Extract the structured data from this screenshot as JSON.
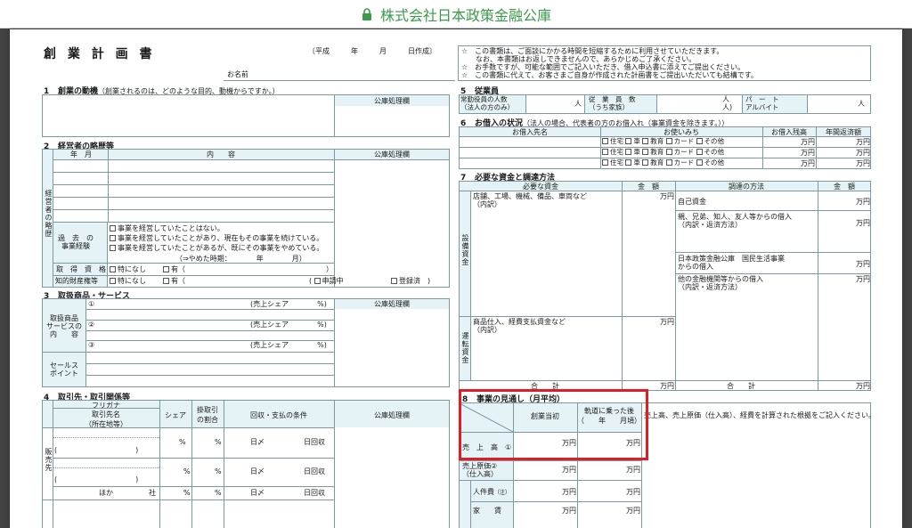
{
  "browser": {
    "title": "株式会社日本政策金融公庫",
    "accent": "#3a9b4a"
  },
  "doc": {
    "title": "創 業 計 画 書",
    "date_line": "〔平成　　　年　　　月　　　日作成〕",
    "name_label": "お名前",
    "notes": [
      "☆　この書類は、ご面談にかかる時間を短縮するために利用させていただきます。",
      "　　なお、本書類はお返しできませんので、あらかじめご了承ください。",
      "☆　お手数ですが、可能な範囲でご記入いただき、借入申込書に添えてご提出ください。",
      "☆　この書類に代えて、お客さまご自身が作成された計画書をご提出いただいても結構です。"
    ],
    "office_col": "公庫処理欄",
    "s1": {
      "num": "1",
      "title": "創業の動機",
      "sub": "（創業されるのは、どのような目的、動機からですか。）"
    },
    "s2": {
      "num": "2",
      "title": "経営者の略歴等",
      "col_ym": "年　月",
      "col_content": "内　　容",
      "side": "経営者の略歴",
      "past": "過　去　の\n事業経験",
      "opt1": "事業を経営していたことはない。",
      "opt2": "事業を経営していたことがあり、現在もその事業を続けている。",
      "opt3": "事業を経営していたことがあるが、既にその事業をやめている。",
      "quit": "（⇒やめた時期：　　　　年　　　　月）",
      "lic_label": "取　得　資　格",
      "none": "特になし",
      "have": "有（",
      "ip_label": "知的財産権等",
      "applying": "申請中",
      "registered": "登録済",
      "close": "）"
    },
    "s3": {
      "num": "3",
      "title": "取扱商品・サービス",
      "label": "取扱商品\nサービスの\n内　　容",
      "item1": "①",
      "item2": "②",
      "item3": "③",
      "share": "(売上シェア　　　　%)",
      "sales_label": "セールス\nポイント"
    },
    "s4": {
      "num": "4",
      "title": "取引先・取引関係等",
      "furigana": "フリガナ",
      "client_name": "取引先名\n（所在地等）",
      "share": "シェア",
      "credit": "掛取引\nの割合",
      "terms": "回収・支払の条件",
      "side": "販売先",
      "pct": "%",
      "day": "日〆",
      "collect": "日回収",
      "other": "ほか　　　　　社",
      "paren": "(　　　　　　　　　　　)"
    },
    "s5": {
      "num": "5",
      "title": "従業員",
      "emp": "常勤役員の人数\n（法人の方のみ）",
      "unit_person": "人",
      "staff": "従　業　員　数\n（うち家族）",
      "staff_unit": "人\n人)",
      "part": "パ　ー　ト\nアルバイト"
    },
    "s6": {
      "num": "6",
      "title": "お借入の状況",
      "sub": "（法人の場合、代表者の方のお借入れ（事業資金を除きます。））",
      "lender": "お借入先名",
      "purpose": "お使いみち",
      "balance": "お借入残高",
      "repay": "年間返済額",
      "uses": [
        "住宅",
        "車",
        "教育",
        "カード",
        "その他"
      ],
      "man": "万円"
    },
    "s7": {
      "num": "7",
      "title": "必要な資金と調達方法",
      "need": "必要な資金",
      "amount": "金　額",
      "method": "調達の方法",
      "capex_side": "設備資金",
      "capex": "店舗、工場、機械、備品、車両など\n（内訳）",
      "opex_side": "運転資金",
      "opex": "商品仕入、経費支払資金など\n（内訳）",
      "own": "自己資金",
      "family": "親、兄弟、知人、友人等からの借入\n（内訳・返済方法）",
      "jfc": "日本政策金融公庫　国民生活事業\nからの借入",
      "other": "他の金融機関等からの借入\n（内訳・返済方法）",
      "total": "合　　計",
      "man": "万円"
    },
    "s8": {
      "num": "8",
      "title": "事業の見通し（月平均）",
      "start": "創業当初",
      "track": "軌道に乗った後\n（　　年　　月頃）",
      "basis": "売上高、売上原価（仕入高）、経費を計算された根拠をご記入ください。",
      "sales": "売　上　高　①",
      "cogs": "売上原価②\n（仕入高）",
      "labor": "人件費",
      "labor_note": "（注）",
      "rent": "家　　賃",
      "man": "万円"
    }
  }
}
